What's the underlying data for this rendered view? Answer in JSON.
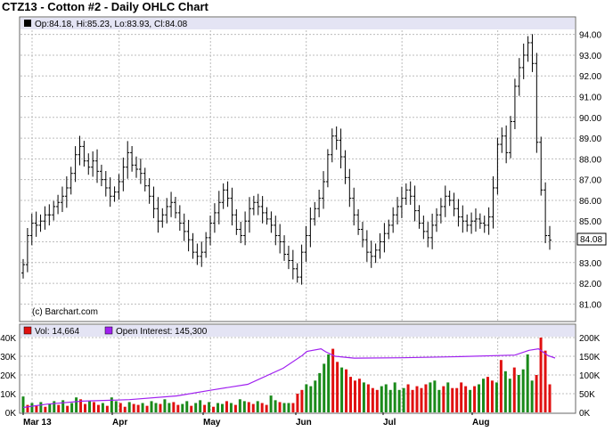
{
  "title": "CTZ13 - Cotton #2 - Daily OHLC Chart",
  "price_legend": "Op:84.18, Hi:85.23, Lo:83.93, Cl:84.08",
  "credit": "(c) Barchart.com",
  "last_price_tag": "84.08",
  "volume_legend": {
    "vol": "Vol: 14,664",
    "oi": "Open Interest: 145,300"
  },
  "colors": {
    "up": "#1a8a1a",
    "down": "#e01010",
    "oi": "#a020f0",
    "panel": "#e4e4f4",
    "grid": "#bcbcbc"
  },
  "chart_data": [
    {
      "type": "ohlc",
      "title": "CTZ13 - Cotton #2 - Daily OHLC Chart",
      "x_labels": [
        "Mar 13",
        "Apr",
        "May",
        "Jun",
        "Jul",
        "Aug"
      ],
      "y_ticks": [
        "81.00",
        "82.00",
        "83.00",
        "84.00",
        "85.00",
        "86.00",
        "87.00",
        "88.00",
        "89.00",
        "90.00",
        "91.00",
        "92.00",
        "93.00",
        "94.00"
      ],
      "ylim": [
        80.2,
        94.2
      ],
      "last_close": 84.08,
      "legend": "Op:84.18, Hi:85.23, Lo:83.93, Cl:84.08",
      "closes": [
        82.9,
        84.3,
        84.9,
        84.8,
        85.0,
        85.3,
        85.3,
        85.7,
        85.9,
        86.2,
        86.6,
        87.3,
        88.2,
        88.6,
        87.9,
        87.6,
        87.9,
        87.4,
        87.0,
        86.6,
        86.2,
        86.4,
        86.9,
        87.6,
        88.3,
        87.7,
        87.5,
        87.3,
        86.7,
        86.2,
        85.6,
        85.0,
        85.3,
        85.7,
        85.9,
        85.4,
        84.9,
        84.5,
        84.1,
        83.5,
        83.3,
        83.5,
        84.2,
        84.9,
        85.4,
        85.9,
        86.5,
        86.1,
        85.3,
        84.6,
        84.3,
        85.0,
        85.6,
        85.9,
        85.7,
        85.4,
        85.1,
        84.8,
        84.3,
        84.0,
        83.4,
        83.1,
        82.7,
        82.3,
        83.5,
        84.3,
        85.1,
        85.6,
        86.1,
        86.9,
        88.2,
        89.1,
        88.9,
        88.1,
        87.1,
        86.1,
        85.3,
        84.6,
        84.1,
        83.5,
        83.3,
        83.6,
        84.0,
        84.4,
        84.8,
        85.3,
        85.7,
        86.1,
        86.5,
        86.2,
        85.5,
        84.9,
        84.5,
        84.2,
        84.8,
        85.3,
        85.7,
        86.2,
        86.0,
        85.6,
        85.2,
        85.0,
        84.8,
        85.0,
        85.1,
        84.9,
        84.8,
        85.2,
        86.6,
        88.7,
        89.1,
        88.3,
        89.8,
        91.5,
        92.4,
        93.0,
        93.6,
        92.6,
        88.8,
        86.5,
        84.3,
        84.08
      ],
      "volume": {
        "ylim": [
          0,
          40000
        ],
        "y_ticks": [
          "0K",
          "10K",
          "20K",
          "30K",
          "40K"
        ],
        "values": [
          8500,
          4000,
          5000,
          3500,
          5500,
          3000,
          4500,
          6000,
          4000,
          6500,
          3500,
          5000,
          8000,
          7000,
          4500,
          6000,
          5500,
          4000,
          5000,
          3500,
          8000,
          6000,
          5000,
          3000,
          5500,
          4500,
          4000,
          5000,
          3500,
          6000,
          5000,
          4500,
          7000,
          5000,
          5500,
          4000,
          4500,
          6000,
          3500,
          5000,
          6500,
          4000,
          5500,
          3000,
          5000,
          4500,
          6000,
          5000,
          4000,
          7000,
          6000,
          5500,
          4500,
          6000,
          5000,
          4000,
          9000,
          6500,
          5500,
          5000,
          5000,
          5000,
          10000,
          12000,
          15000,
          14000,
          17000,
          21000,
          26000,
          31000,
          34000,
          27000,
          24000,
          23000,
          19000,
          17000,
          18000,
          16000,
          15000,
          13000,
          12000,
          14000,
          15000,
          12000,
          16000,
          12000,
          13000,
          15000,
          12000,
          14000,
          13000,
          15000,
          16000,
          17000,
          12000,
          14000,
          16000,
          13000,
          13000,
          16000,
          14000,
          12000,
          14000,
          15000,
          18000,
          19000,
          17000,
          16000,
          28000,
          22000,
          18000,
          24000,
          20000,
          23000,
          31000,
          17000,
          20000,
          41000,
          33000,
          15000
        ],
        "up": [
          true,
          false,
          true,
          false,
          true,
          false,
          true,
          true,
          false,
          true,
          false,
          true,
          true,
          false,
          false,
          true,
          false,
          false,
          true,
          false,
          true,
          true,
          false,
          false,
          true,
          false,
          false,
          true,
          false,
          true,
          true,
          false,
          true,
          true,
          false,
          false,
          true,
          true,
          false,
          true,
          true,
          false,
          true,
          false,
          true,
          true,
          false,
          true,
          false,
          true,
          true,
          false,
          false,
          true,
          false,
          false,
          true,
          true,
          false,
          true,
          true,
          false,
          false,
          false,
          true,
          true,
          true,
          true,
          true,
          true,
          false,
          false,
          true,
          false,
          false,
          false,
          false,
          true,
          false,
          false,
          false,
          true,
          true,
          true,
          true,
          true,
          true,
          false,
          false,
          false,
          false,
          false,
          true,
          true,
          true,
          false,
          true,
          false,
          false,
          false,
          false,
          true,
          false,
          true,
          true,
          false,
          false,
          true,
          false,
          true,
          true,
          false,
          true,
          true,
          true,
          true,
          false,
          false,
          false,
          false
        ]
      },
      "open_interest": {
        "ylim": [
          0,
          200000
        ],
        "y_ticks": [
          "0K",
          "50K",
          "100K",
          "150K",
          "200K"
        ],
        "anchors": [
          [
            0,
            13000
          ],
          [
            10,
            22000
          ],
          [
            25,
            30000
          ],
          [
            45,
            34000
          ],
          [
            65,
            44000
          ],
          [
            80,
            60000
          ],
          [
            95,
            75000
          ],
          [
            110,
            118000
          ],
          [
            118,
            152000
          ],
          [
            120,
            163000
          ],
          [
            126,
            170000
          ],
          [
            128,
            162000
          ],
          [
            132,
            150000
          ],
          [
            140,
            145000
          ],
          [
            160,
            146000
          ],
          [
            185,
            149000
          ],
          [
            208,
            153000
          ],
          [
            214,
            166000
          ],
          [
            218,
            170000
          ],
          [
            222,
            152000
          ],
          [
            225,
            145300
          ]
        ]
      }
    }
  ]
}
